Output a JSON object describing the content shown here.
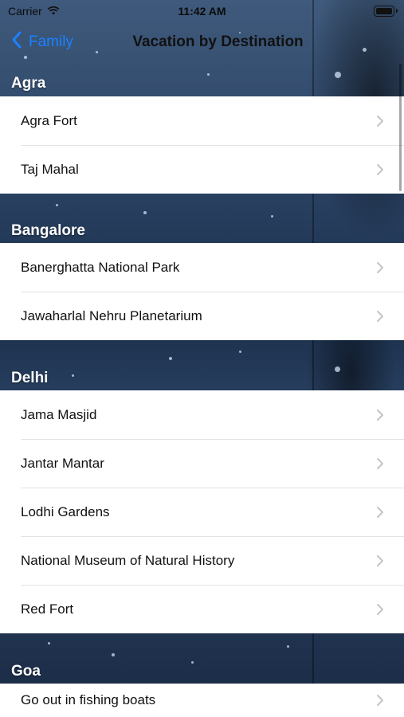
{
  "status_bar": {
    "carrier": "Carrier",
    "time": "11:42 AM"
  },
  "nav": {
    "back_label": "Family",
    "title": "Vacation by Destination"
  },
  "colors": {
    "accent": "#1a82ff",
    "cell_bg": "#ffffff",
    "separator": "#e3e3e6",
    "chevron": "#c4c4c7"
  },
  "sections": [
    {
      "header": "Agra",
      "items": [
        "Agra Fort",
        "Taj Mahal"
      ]
    },
    {
      "header": "Bangalore",
      "items": [
        "Banerghatta National Park",
        "Jawaharlal Nehru Planetarium"
      ]
    },
    {
      "header": "Delhi",
      "items": [
        "Jama Masjid",
        "Jantar Mantar",
        "Lodhi Gardens",
        "National Museum of Natural History",
        "Red Fort"
      ]
    },
    {
      "header": "Goa",
      "items": [
        "Go out in fishing boats"
      ]
    }
  ]
}
